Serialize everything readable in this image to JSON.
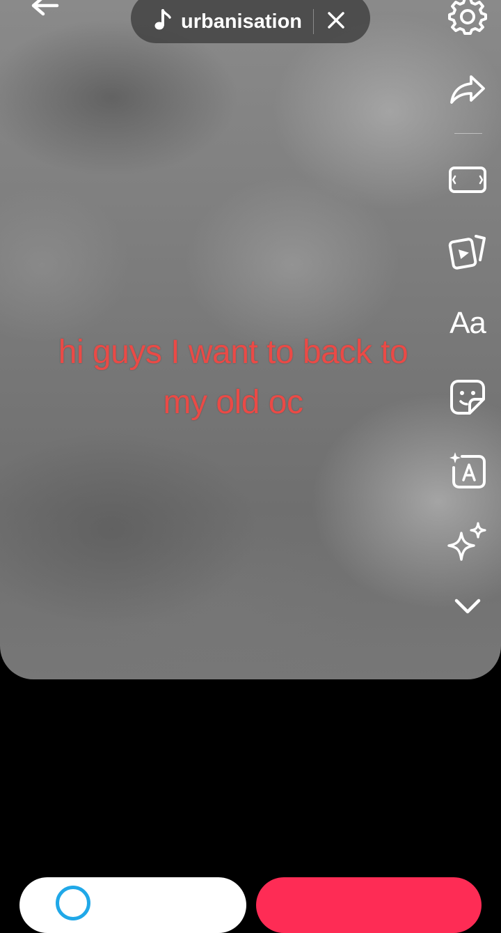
{
  "editor": {
    "caption_lines": [
      "hi guys I want to back to",
      "my old oc"
    ]
  },
  "sound": {
    "name": "urbanisation"
  },
  "icons": {
    "back": "arrow-left-icon",
    "music": "music-note-icon",
    "close": "close-icon",
    "settings": "gear-icon",
    "share": "share-arrow-icon",
    "crop": "aspect-ratio-icon",
    "templates": "video-templates-icon",
    "text": "text-icon",
    "sticker": "sticker-icon",
    "text_to_speech": "ai-text-icon",
    "effects": "sparkles-icon",
    "more": "chevron-down-icon"
  },
  "toolbar": {
    "text_label": "Aa"
  },
  "colors": {
    "caption": "#ea4a46",
    "primary_button": "#fe2c55",
    "secondary_button": "#ffffff",
    "accent_ring": "#20a8e8"
  }
}
